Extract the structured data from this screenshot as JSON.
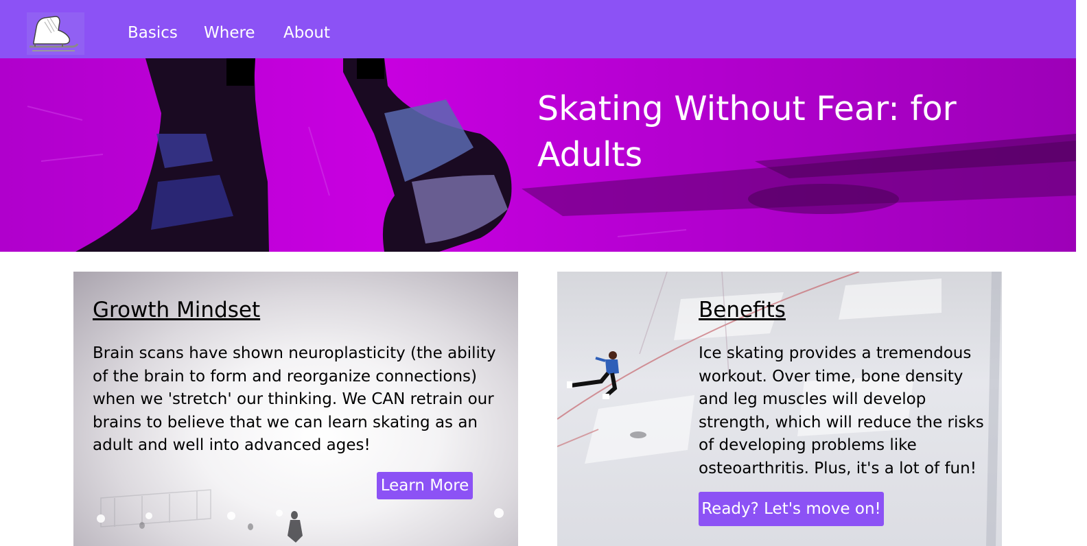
{
  "nav": {
    "logo_icon": "ice-skate-icon",
    "links": [
      {
        "label": "Basics"
      },
      {
        "label": "Where"
      },
      {
        "label": "About"
      }
    ]
  },
  "hero": {
    "title": "Skating Without Fear: for Adults"
  },
  "cards": [
    {
      "heading": "Growth Mindset",
      "body": "Brain scans have shown neuroplasticity (the ability of the brain to form and reorganize connections) when we 'stretch' our thinking. We CAN retrain our brains to believe that we can learn skating as an adult and well into advanced ages!",
      "button": "Learn More"
    },
    {
      "heading": "Benefits",
      "body": "Ice skating provides a tremendous workout. Over time, bone density and leg muscles will develop strength, which will reduce the risks of developing problems like osteoarthritis. Plus, it's a lot of fun!",
      "button": "Ready? Let's move on!"
    }
  ],
  "colors": {
    "accent": "#8c52f5",
    "hero_tint": "#c000dc",
    "text": "#000000"
  }
}
